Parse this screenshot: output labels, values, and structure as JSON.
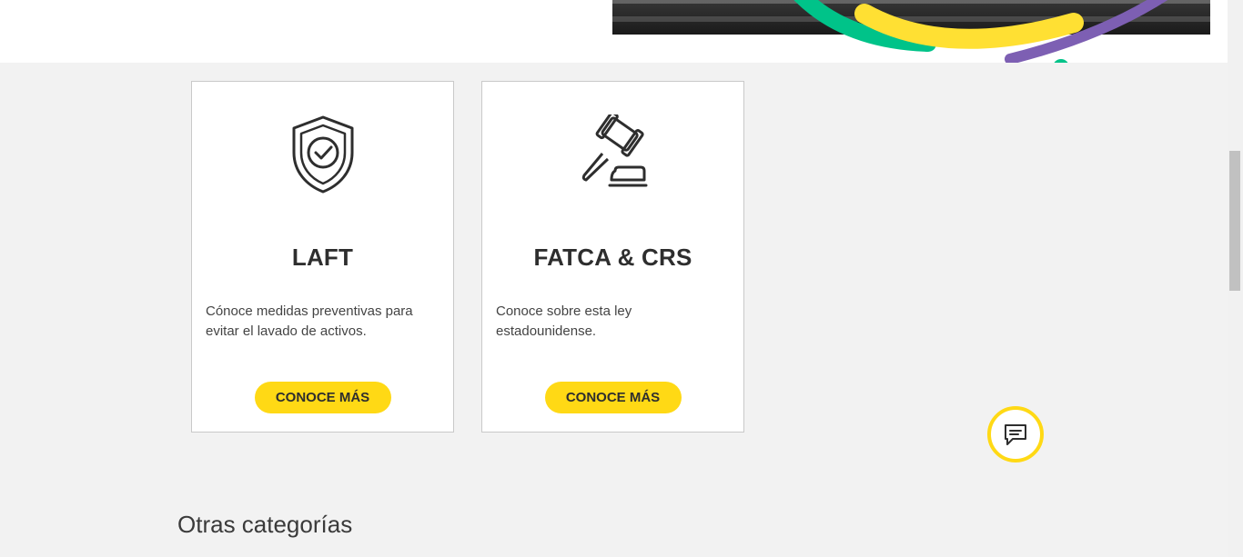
{
  "cards": [
    {
      "title": "LAFT",
      "description": "Cónoce medidas preventivas para evitar el lavado de activos.",
      "button_label": "CONOCE MÁS",
      "icon": "shield-check-icon"
    },
    {
      "title": "FATCA & CRS",
      "description": "Conoce sobre esta ley estadounidense.",
      "button_label": "CONOCE MÁS",
      "icon": "gavel-icon"
    }
  ],
  "section": {
    "title": "Otras categorías"
  },
  "chat": {
    "icon": "chat-icon"
  },
  "colors": {
    "accent": "#ffd915",
    "background": "#f2f2f2",
    "arc_green": "#00c389",
    "arc_yellow": "#ffe033",
    "arc_purple": "#7d5fb3"
  }
}
